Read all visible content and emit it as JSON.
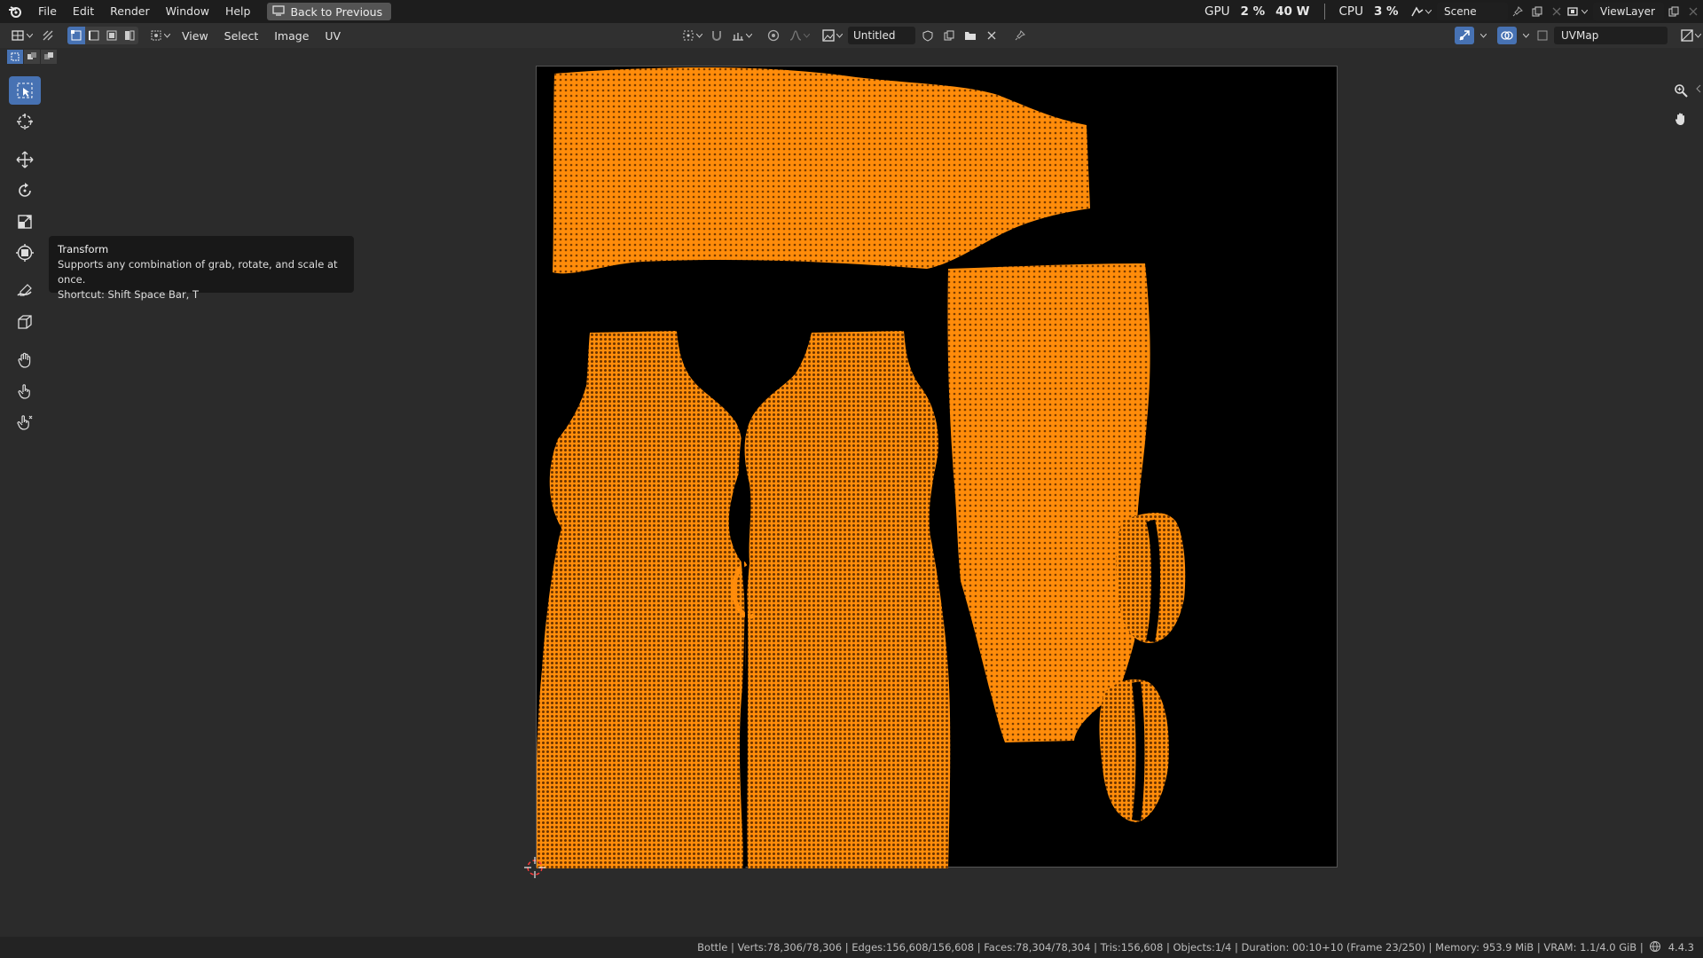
{
  "menu": {
    "items": [
      "File",
      "Edit",
      "Render",
      "Window",
      "Help"
    ],
    "back_label": "Back to Previous"
  },
  "stats": {
    "gpu_label": "GPU",
    "gpu_value": "2 %",
    "gpu_power": "40 W",
    "cpu_label": "CPU",
    "cpu_value": "3 %"
  },
  "scene": {
    "name": "Scene"
  },
  "view_layer": {
    "name": "ViewLayer"
  },
  "header": {
    "menus": [
      "View",
      "Select",
      "Image",
      "UV"
    ],
    "image_name": "Untitled",
    "uv_map": "UVMap"
  },
  "tooltip": {
    "title": "Transform",
    "description": "Supports any combination of grab, rotate, and scale at once.",
    "shortcut": "Shortcut: Shift Space Bar, T"
  },
  "statusbar": {
    "text": "Bottle | Verts:78,306/78,306 | Edges:156,608/156,608 | Faces:78,304/78,304 | Tris:156,608 | Objects:1/4 | Duration: 00:10+10 (Frame 23/250) | Memory: 953.9 MiB | VRAM: 1.1/4.0 GiB |",
    "version": "4.4.3"
  },
  "colors": {
    "accent": "#4772b3",
    "uv_fill": "#ff8c0a",
    "background": "#2b2b2b"
  },
  "icons": {
    "tools": [
      "select-box-icon",
      "cursor-icon",
      "move-icon",
      "rotate-icon",
      "scale-icon",
      "transform-icon",
      "annotate-icon",
      "rip-icon",
      "grab-icon",
      "relax-icon",
      "pinch-icon"
    ]
  }
}
